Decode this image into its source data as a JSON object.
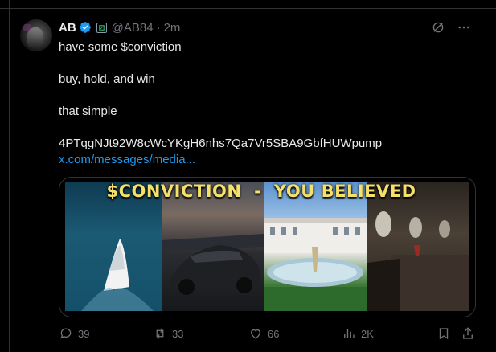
{
  "tweet": {
    "display_name": "AB",
    "handle": "@AB84",
    "separator": "·",
    "time": "2m",
    "paragraphs": [
      "have some $conviction",
      "buy, hold, and win",
      "that simple",
      "4PTqgNJt92W8cWcYKgH6nhs7Qa7Vr5SBA9GbfHUWpump"
    ],
    "link_text": "x.com/messages/media..."
  },
  "media": {
    "banner_text": "$CONVICTION  -  YOU BELIEVED",
    "panels": [
      "yacht",
      "sports-car",
      "mansion",
      "private-jet-interior"
    ]
  },
  "engagement": {
    "replies": "39",
    "reposts": "33",
    "likes": "66",
    "views": "2K"
  },
  "icons": {
    "verified": "verified-badge-icon",
    "affiliate": "affiliate-badge-icon",
    "grok": "grok-icon",
    "more": "more-icon",
    "reply": "reply-icon",
    "repost": "repost-icon",
    "like": "heart-icon",
    "views": "views-icon",
    "bookmark": "bookmark-icon",
    "share": "share-icon"
  },
  "colors": {
    "background": "#000000",
    "text": "#e7e9ea",
    "secondary": "#71767b",
    "link": "#1d9bf0",
    "banner": "#f5e06a"
  }
}
